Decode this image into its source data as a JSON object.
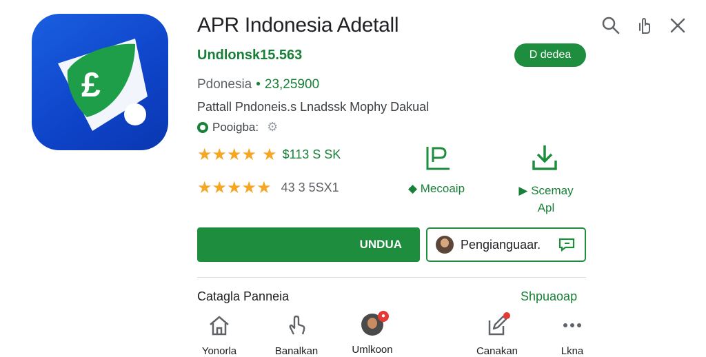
{
  "header": {
    "title": "APR Indonesia Adetall",
    "subtitle": "Undlonsk15.563",
    "download_pill": "D dedea",
    "meta_region": "Pdonesia",
    "meta_dot": "•",
    "meta_value": "23,25900",
    "description": "Pattall Pndoneis.s Lnadssk Mophy Dakual",
    "badge": "Pooigba:",
    "top_icons": [
      "search-icon",
      "hand-pointer-icon",
      "close-icon"
    ]
  },
  "ratings": {
    "row1_stars": "★★★★",
    "row1_text": "$113 S SK",
    "row2_stars": "★★★★",
    "row2_text": "43 3 5SX1"
  },
  "actions": {
    "action1_label": "Mecoaip",
    "action2_label": "Scemay",
    "action2_sub": "Apl",
    "action1_icon": "flag-p-icon",
    "action2_icon": "download-icon"
  },
  "buttons": {
    "install": "UNDUA",
    "secondary": "Pengianguaar."
  },
  "section": {
    "title": "Catagla Panneia",
    "link": "Shpuaoap"
  },
  "bottom_nav": [
    {
      "label": "Yonorla",
      "icon": "home-icon"
    },
    {
      "label": "Banalkan",
      "icon": "touch-icon"
    },
    {
      "label": "Umlkoon",
      "icon": "profile-avatar-icon"
    },
    {
      "label": "Canakan",
      "icon": "edit-icon"
    },
    {
      "label": "Lkna",
      "icon": "more-icon"
    }
  ],
  "colors": {
    "accent_green": "#1e8e3e",
    "icon_blue": "#0e43c8",
    "star": "#f5a623"
  }
}
